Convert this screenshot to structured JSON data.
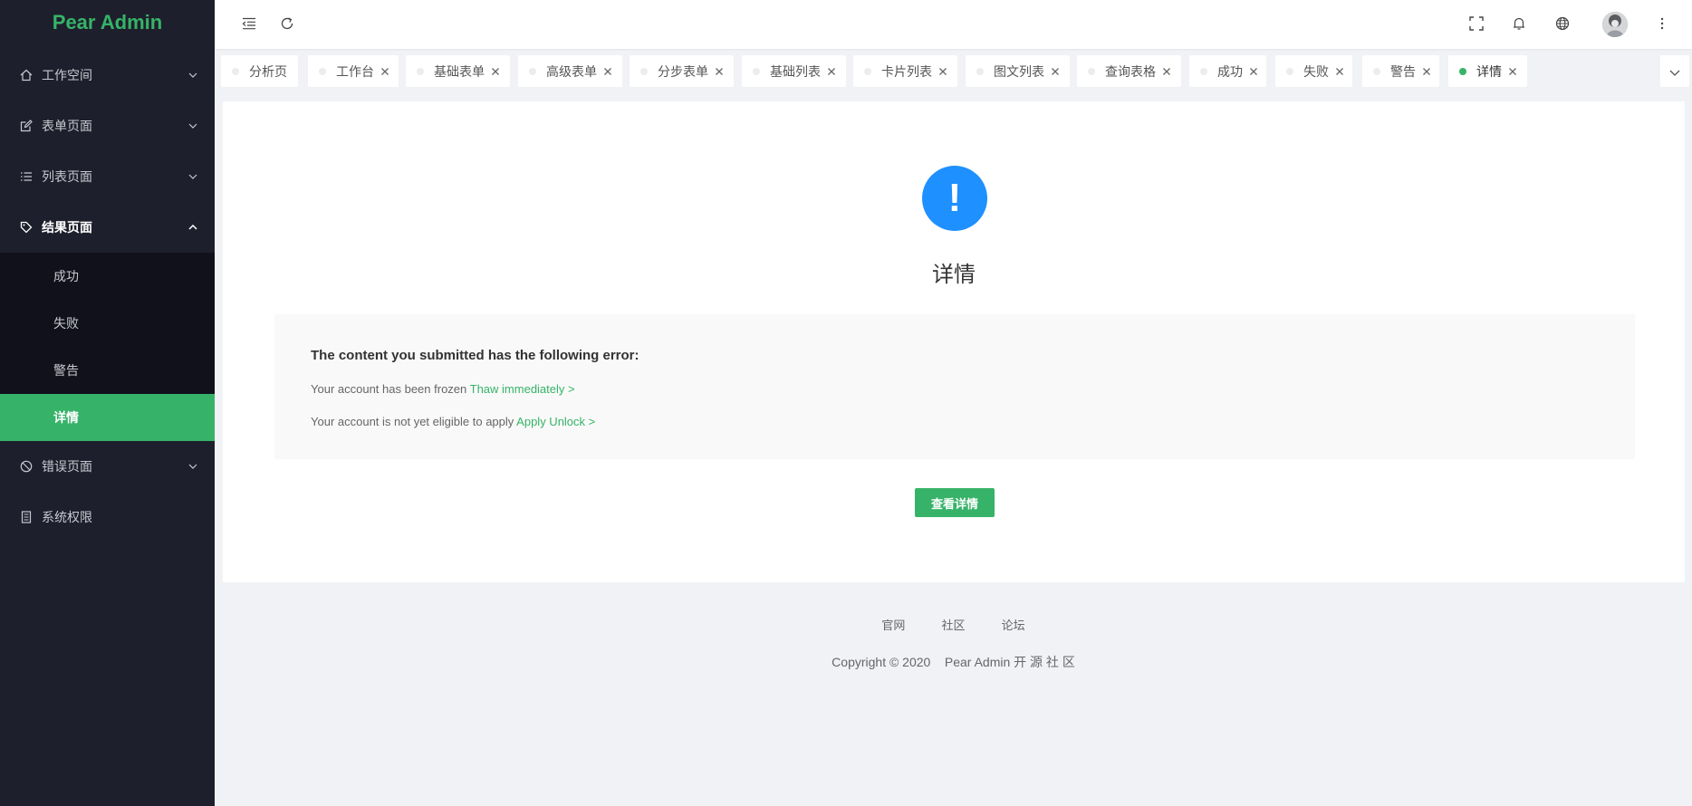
{
  "app": {
    "logo": "Pear Admin",
    "brand_color": "#36b368",
    "sidebar_bg": "#1e1f2c",
    "submenu_bg": "#10111a"
  },
  "sidebar": {
    "items": [
      {
        "label": "工作空间",
        "icon": "home-icon",
        "state": "collapsed"
      },
      {
        "label": "表单页面",
        "icon": "edit-icon",
        "state": "collapsed"
      },
      {
        "label": "列表页面",
        "icon": "list-icon",
        "state": "collapsed"
      },
      {
        "label": "结果页面",
        "icon": "tag-icon",
        "state": "expanded"
      },
      {
        "label": "错误页面",
        "icon": "ban-icon",
        "state": "collapsed"
      },
      {
        "label": "系统权限",
        "icon": "document-icon",
        "state": "none"
      }
    ],
    "sub_items": [
      {
        "label": "成功"
      },
      {
        "label": "失败"
      },
      {
        "label": "警告"
      },
      {
        "label": "详情",
        "active": true
      }
    ]
  },
  "header": {
    "icons": [
      "menu-toggle-icon",
      "refresh-icon",
      "fullscreen-icon",
      "bell-icon",
      "globe-icon",
      "avatar",
      "more-vertical-icon"
    ]
  },
  "tabs": [
    {
      "label": "分析页",
      "closable": false
    },
    {
      "label": "工作台",
      "closable": true
    },
    {
      "label": "基础表单",
      "closable": true
    },
    {
      "label": "高级表单",
      "closable": true
    },
    {
      "label": "分步表单",
      "closable": true
    },
    {
      "label": "基础列表",
      "closable": true
    },
    {
      "label": "卡片列表",
      "closable": true
    },
    {
      "label": "图文列表",
      "closable": true
    },
    {
      "label": "查询表格",
      "closable": true
    },
    {
      "label": "成功",
      "closable": true
    },
    {
      "label": "失败",
      "closable": true
    },
    {
      "label": "警告",
      "closable": true
    },
    {
      "label": "详情",
      "closable": true,
      "active": true
    }
  ],
  "result": {
    "icon": "exclamation-icon",
    "icon_symbol": "!",
    "icon_color": "#1e90ff",
    "title": "详情",
    "desc_heading": "The content you submitted has the following error:",
    "line1_text": "Your account has been frozen ",
    "line1_link": "Thaw immediately >",
    "line2_text": "Your account is not yet eligible to apply ",
    "line2_link": "Apply Unlock >",
    "button": "查看详情"
  },
  "footer": {
    "links": [
      "官网",
      "社区",
      "论坛"
    ],
    "copyright": "Copyright © 2020    Pear Admin 开 源 社 区"
  }
}
